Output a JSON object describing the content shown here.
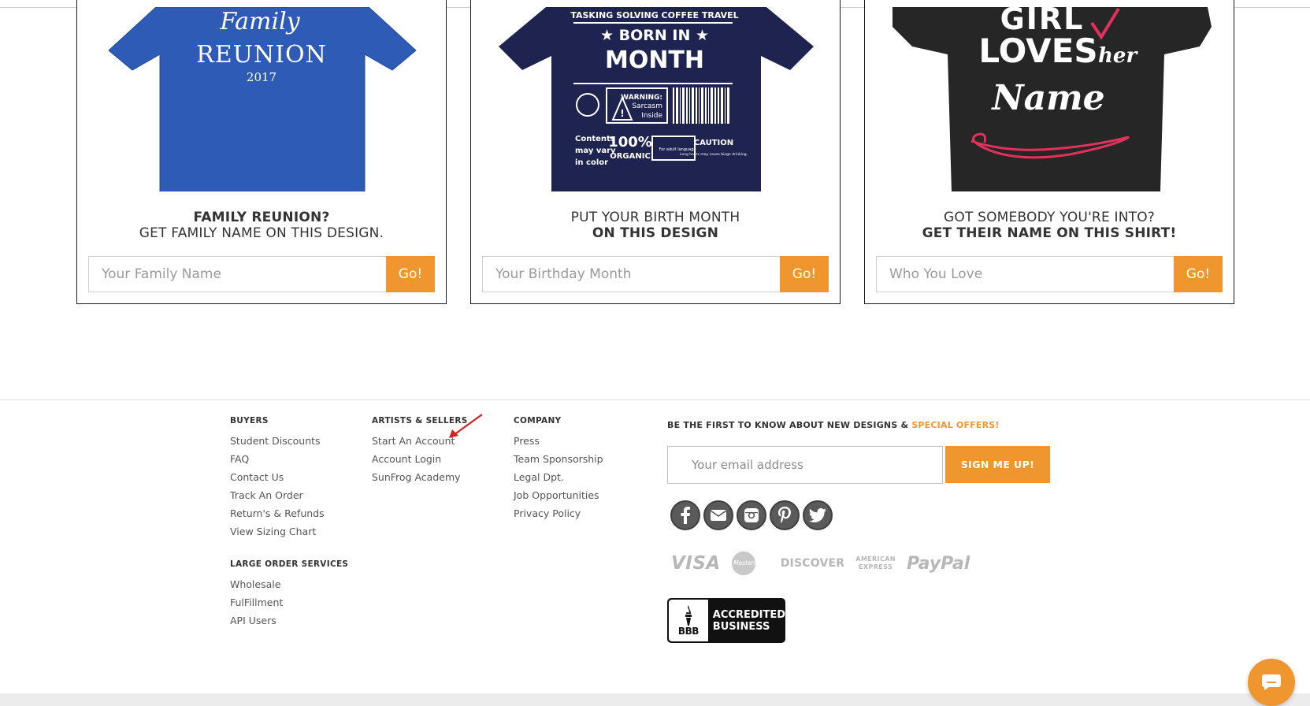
{
  "cards": [
    {
      "line1": "FAMILY REUNION?",
      "line2": "GET FAMILY NAME ON THIS DESIGN.",
      "placeholder": "Your Family Name",
      "button": "Go!",
      "shirt_text": {
        "script": "Family",
        "title": "REUNION",
        "year": "2017"
      },
      "shirt_color": "#2d5bb5"
    },
    {
      "line1": "PUT YOUR BIRTH MONTH",
      "line2": "ON THIS DESIGN",
      "placeholder": "Your Birthday Month",
      "button": "Go!",
      "shirt_text": {
        "top": "TASKING   SOLVING   COFFEE   TRAVEL",
        "born": "★ BORN IN ★",
        "month": "MONTH",
        "warning": "WARNING:",
        "sarcasm": "Sarcasm",
        "inside": "Inside",
        "contents1": "Contents",
        "contents2": "may vary",
        "contents3": "in color",
        "organic_pct": "100%",
        "organic": "ORGANIC",
        "adult": "For adult language",
        "caution": "CAUTION",
        "caution_sub": "Long hours may cause binge drinking."
      },
      "shirt_color": "#1f2350"
    },
    {
      "line1": "GOT SOMEBODY YOU'RE INTO?",
      "line2": "GET THEIR NAME ON THIS SHIRT!",
      "placeholder": "Who You Love",
      "button": "Go!",
      "shirt_text": {
        "girl": "GIRL",
        "loves": "LOVES",
        "her": "her",
        "name": "Name"
      },
      "shirt_color": "#262626"
    }
  ],
  "footer": {
    "buyers": {
      "title": "BUYERS",
      "links": [
        "Student Discounts",
        "FAQ",
        "Contact Us",
        "Track An Order",
        "Return's & Refunds",
        "View Sizing Chart"
      ]
    },
    "large_order": {
      "title": "LARGE ORDER SERVICES",
      "links": [
        "Wholesale",
        "FulFillment",
        "API Users"
      ]
    },
    "artists": {
      "title": "ARTISTS & SELLERS",
      "links": [
        "Start An Account",
        "Account Login",
        "SunFrog Academy"
      ]
    },
    "company": {
      "title": "COMPANY",
      "links": [
        "Press",
        "Team Sponsorship",
        "Legal Dpt.",
        "Job Opportunities",
        "Privacy Policy"
      ]
    },
    "newsletter": {
      "heading": "BE THE FIRST TO KNOW ABOUT NEW DESIGNS & ",
      "heading_accent": "SPECIAL OFFERS!",
      "placeholder": "Your email address",
      "button": "SIGN ME UP!"
    },
    "socials": [
      "facebook-icon",
      "email-icon",
      "instagram-icon",
      "pinterest-icon",
      "twitter-icon"
    ],
    "payments": {
      "visa": "VISA",
      "mastercard": "MasterCard",
      "discover": "DISCOVER",
      "amex_line1": "AMERICAN",
      "amex_line2": "EXPRESS",
      "paypal": "PayPal"
    },
    "bbb": {
      "logo": "BBB",
      "line1": "ACCREDITED",
      "line2": "BUSINESS"
    }
  },
  "colors": {
    "accent": "#f0962e",
    "annotation": "#d42020"
  }
}
